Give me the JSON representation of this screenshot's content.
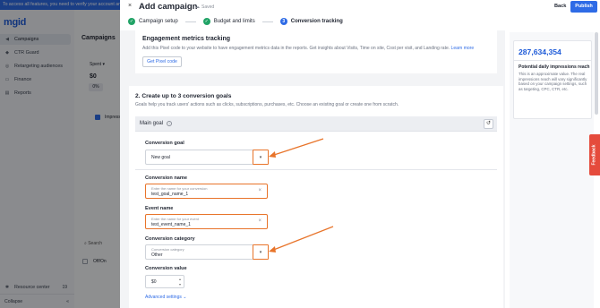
{
  "background": {
    "banner_text": "To access all features, you need to verify your account and ...",
    "logo": "mgid",
    "sidebar_items": [
      {
        "label": "Campaigns",
        "icon": "megaphone-icon"
      },
      {
        "label": "CTR Guard",
        "icon": "shield-icon"
      },
      {
        "label": "Retargeting audiences",
        "icon": "target-icon"
      },
      {
        "label": "Finance",
        "icon": "wallet-icon"
      },
      {
        "label": "Reports",
        "icon": "report-icon"
      }
    ],
    "resource_center": "Resource center",
    "resource_count": "19",
    "collapse": "Collapse",
    "page_title": "Campaigns",
    "spent_label": "Spent",
    "spent_value": "$0",
    "pct": "0%",
    "impressions": "Impress",
    "search": "Search",
    "off_on": "Off/On"
  },
  "header": {
    "close": "×",
    "title": "Add campaign",
    "saved": "Saved",
    "back": "Back",
    "publish": "Publish"
  },
  "steps": [
    {
      "label": "Campaign setup",
      "state": "done",
      "marker": "✓"
    },
    {
      "label": "Budget and limits",
      "state": "done",
      "marker": "✓"
    },
    {
      "label": "Conversion tracking",
      "state": "current",
      "marker": "3"
    }
  ],
  "engagement": {
    "title": "Engagement metrics tracking",
    "desc": "Add this Pixel code to your website to have engagement metrics data in the reports. Get insights about Visits, Time on site, Cost per visit, and Landing rate.",
    "learn_more": "Learn more",
    "button": "Get Pixel code"
  },
  "goals": {
    "title": "2. Create up to 3 conversion goals",
    "desc": "Goals help you track users' actions such as clicks, subscriptions, purchases, etc. Choose an existing goal or create one from scratch.",
    "main_goal": "Main goal",
    "conversion_goal_label": "Conversion goal",
    "conversion_goal_value": "New goal",
    "conversion_name_label": "Conversion name",
    "conversion_name_hint": "Enter the name for your conversion",
    "conversion_name_value": "test_goal_name_1",
    "event_name_label": "Event name",
    "event_name_hint": "Enter the name for your event",
    "event_name_value": "test_event_name_1",
    "category_label": "Conversion category",
    "category_hint": "Conversion category",
    "category_value": "Other",
    "value_label": "Conversion value",
    "value_value": "$0",
    "advanced": "Advanced settings"
  },
  "reach": {
    "number": "287,634,354",
    "title": "Potential daily impressions reach",
    "desc": "This is an approximate value. The real impressions reach will vary significantly based on your campaign settings, such as targeting, CPC, CTR, etc."
  },
  "feedback": "Feedback",
  "colors": {
    "accent": "#2e6be6",
    "highlight": "#e8742a",
    "success": "#21a366",
    "feedback": "#e54b3c"
  }
}
